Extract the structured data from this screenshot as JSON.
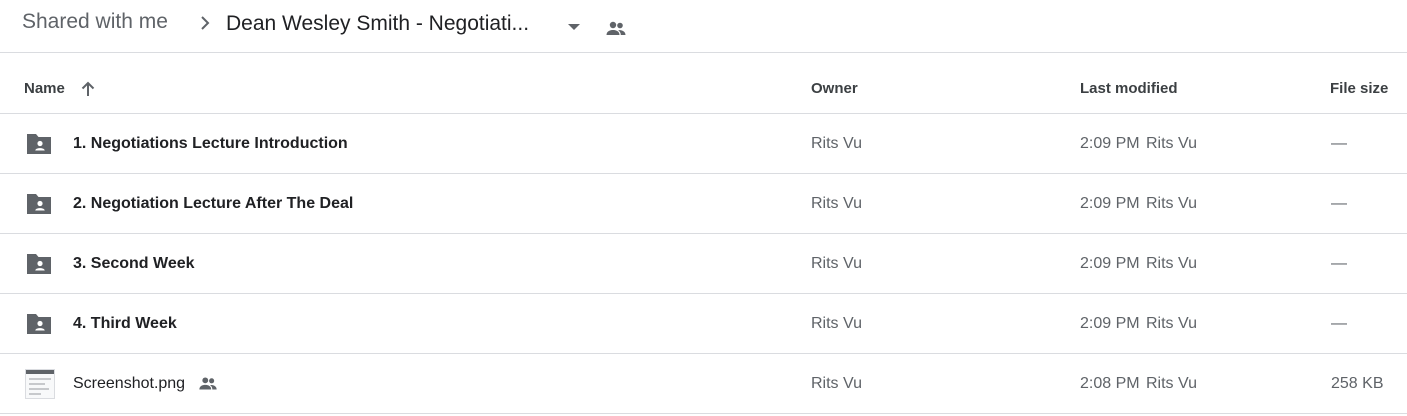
{
  "breadcrumb": {
    "root": "Shared with me",
    "current": "Dean Wesley Smith - Negotiati..."
  },
  "columns": {
    "name": "Name",
    "owner": "Owner",
    "last_modified": "Last modified",
    "file_size": "File size"
  },
  "rows": [
    {
      "name": "1. Negotiations Lecture Introduction",
      "type": "shared-folder",
      "owner": "Rits Vu",
      "modified_time": "2:09 PM",
      "modified_by": "Rits Vu",
      "size": "—"
    },
    {
      "name": "2. Negotiation Lecture After The Deal",
      "type": "shared-folder",
      "owner": "Rits Vu",
      "modified_time": "2:09 PM",
      "modified_by": "Rits Vu",
      "size": "—"
    },
    {
      "name": "3. Second Week",
      "type": "shared-folder",
      "owner": "Rits Vu",
      "modified_time": "2:09 PM",
      "modified_by": "Rits Vu",
      "size": "—"
    },
    {
      "name": "4. Third Week",
      "type": "shared-folder",
      "owner": "Rits Vu",
      "modified_time": "2:09 PM",
      "modified_by": "Rits Vu",
      "size": "—"
    },
    {
      "name": "Screenshot.png",
      "type": "image-file",
      "owner": "Rits Vu",
      "modified_time": "2:08 PM",
      "modified_by": "Rits Vu",
      "size": "258 KB"
    }
  ],
  "icons": {
    "breadcrumb_separator": "chevron-right-icon",
    "dropdown": "arrow-drop-down-icon",
    "shared": "people-icon",
    "sort": "arrow-up-icon",
    "folder": "shared-folder-icon"
  },
  "colors": {
    "icon_gray": "#5f6368",
    "divider": "#dadce0",
    "text_primary": "#202124"
  }
}
